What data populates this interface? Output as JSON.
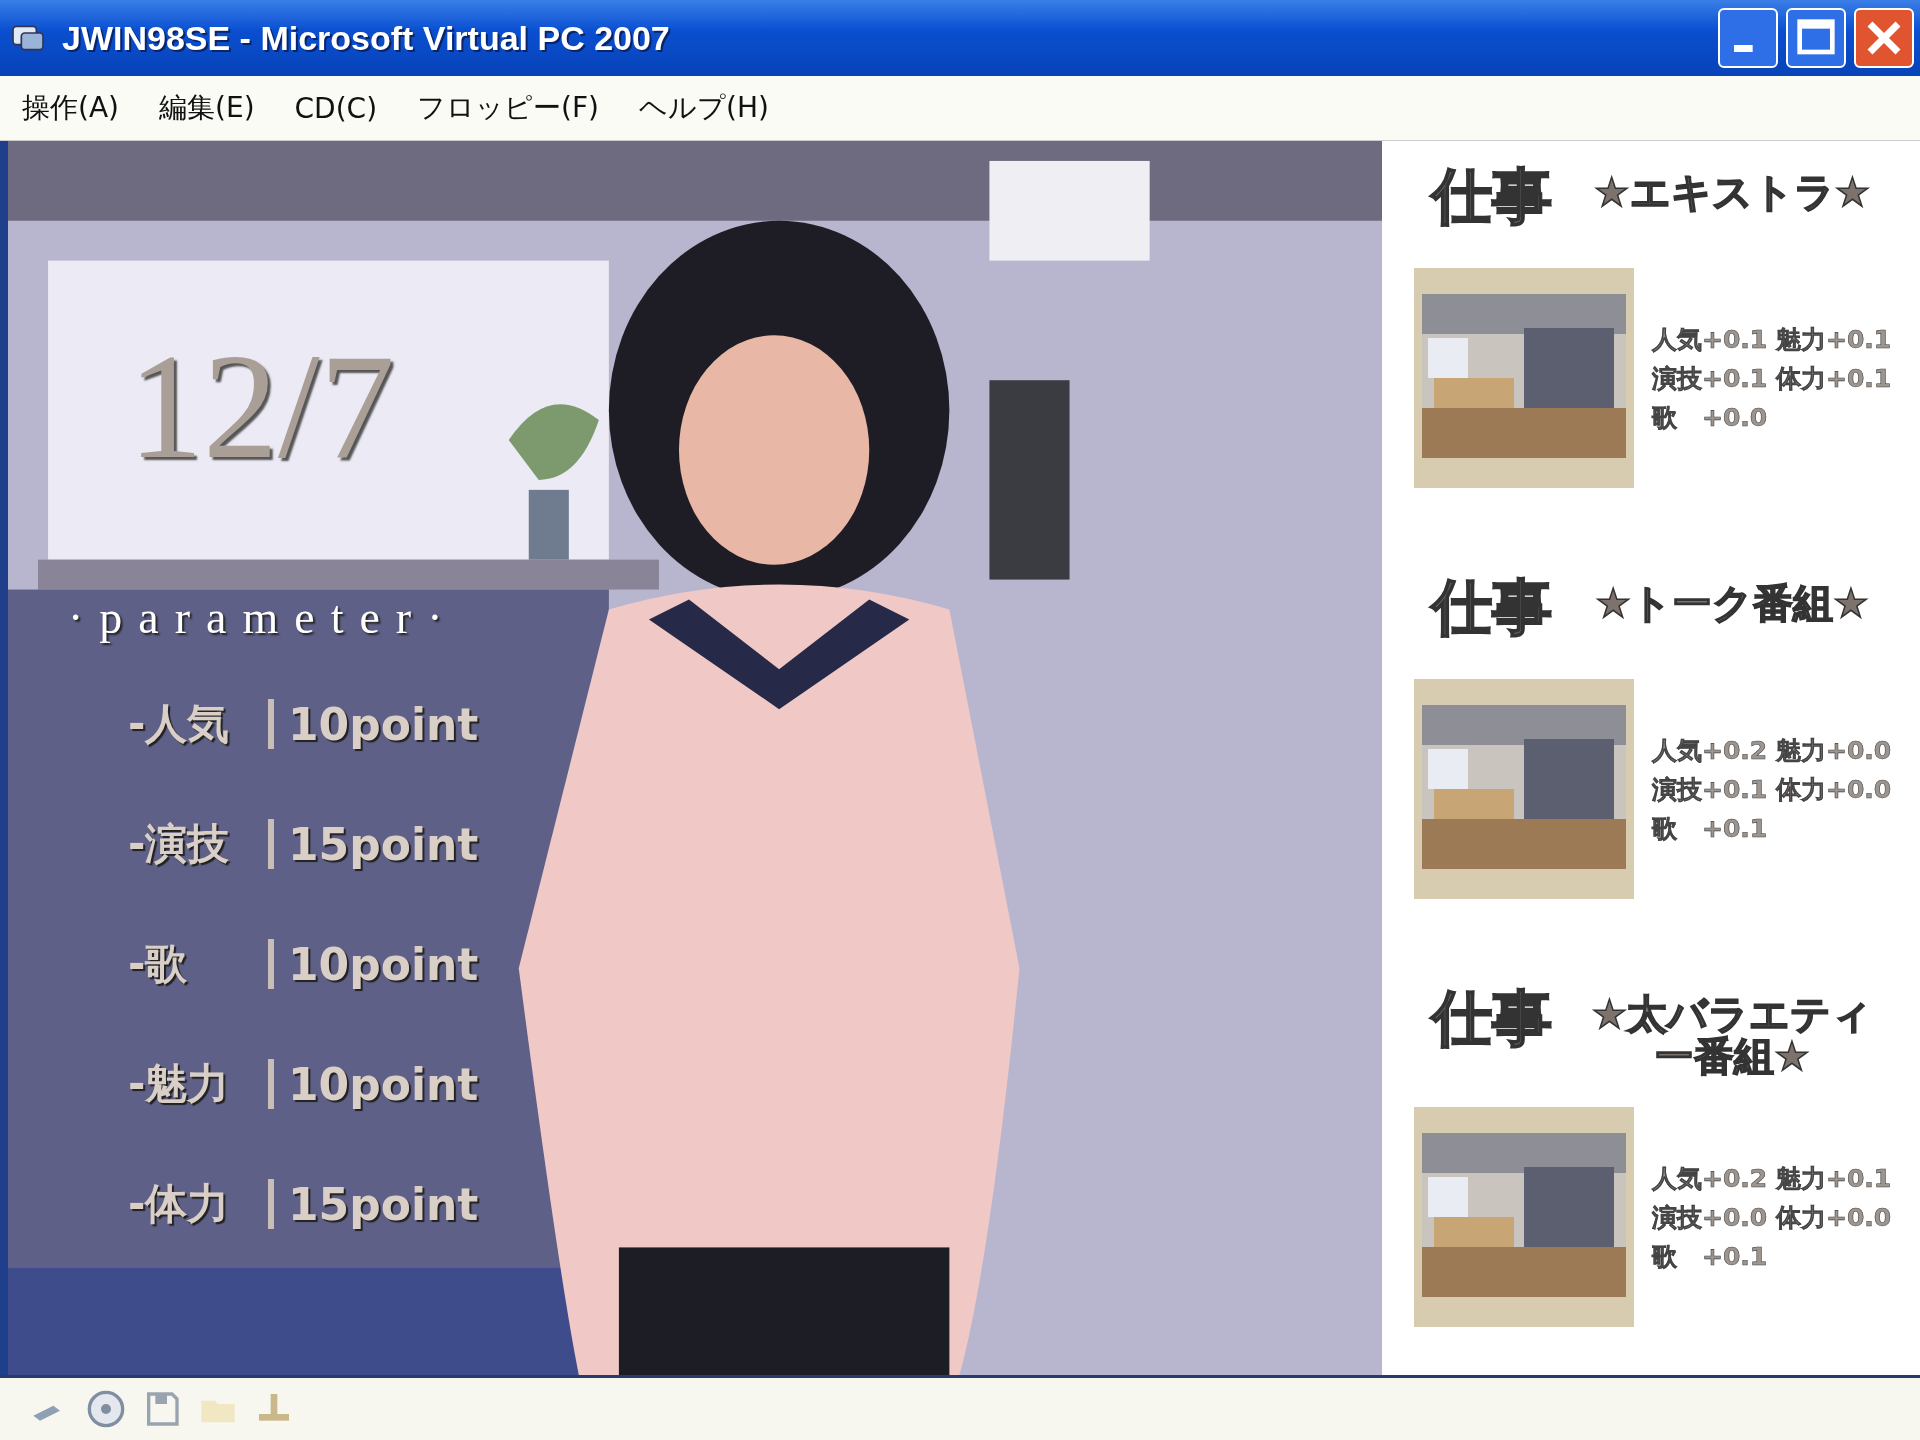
{
  "window": {
    "title": "JWIN98SE - Microsoft Virtual PC 2007"
  },
  "menu": [
    "操作(A)",
    "編集(E)",
    "CD(C)",
    "フロッピー(F)",
    "ヘルプ(H)"
  ],
  "game": {
    "date": "12/7",
    "parameter_heading": "·parameter·",
    "parameters": [
      {
        "label": "-人気",
        "value": "10point"
      },
      {
        "label": "-演技",
        "value": "15point"
      },
      {
        "label": "-歌",
        "value": "10point"
      },
      {
        "label": "-魅力",
        "value": "10point"
      },
      {
        "label": "-体力",
        "value": "15point"
      }
    ]
  },
  "jobs": [
    {
      "title": "仕事",
      "name": "★エキストラ★",
      "stats": [
        "人気+0.1 魅力+0.1",
        "演技+0.1 体力+0.1",
        "歌　+0.0"
      ]
    },
    {
      "title": "仕事",
      "name": "★トーク番組★",
      "stats": [
        "人気+0.2 魅力+0.0",
        "演技+0.1 体力+0.0",
        "歌　+0.1"
      ]
    },
    {
      "title": "仕事",
      "name": "★太バラエティー番組★",
      "stats": [
        "人気+0.2 魅力+0.1",
        "演技+0.0 体力+0.0",
        "歌　+0.1"
      ]
    }
  ]
}
